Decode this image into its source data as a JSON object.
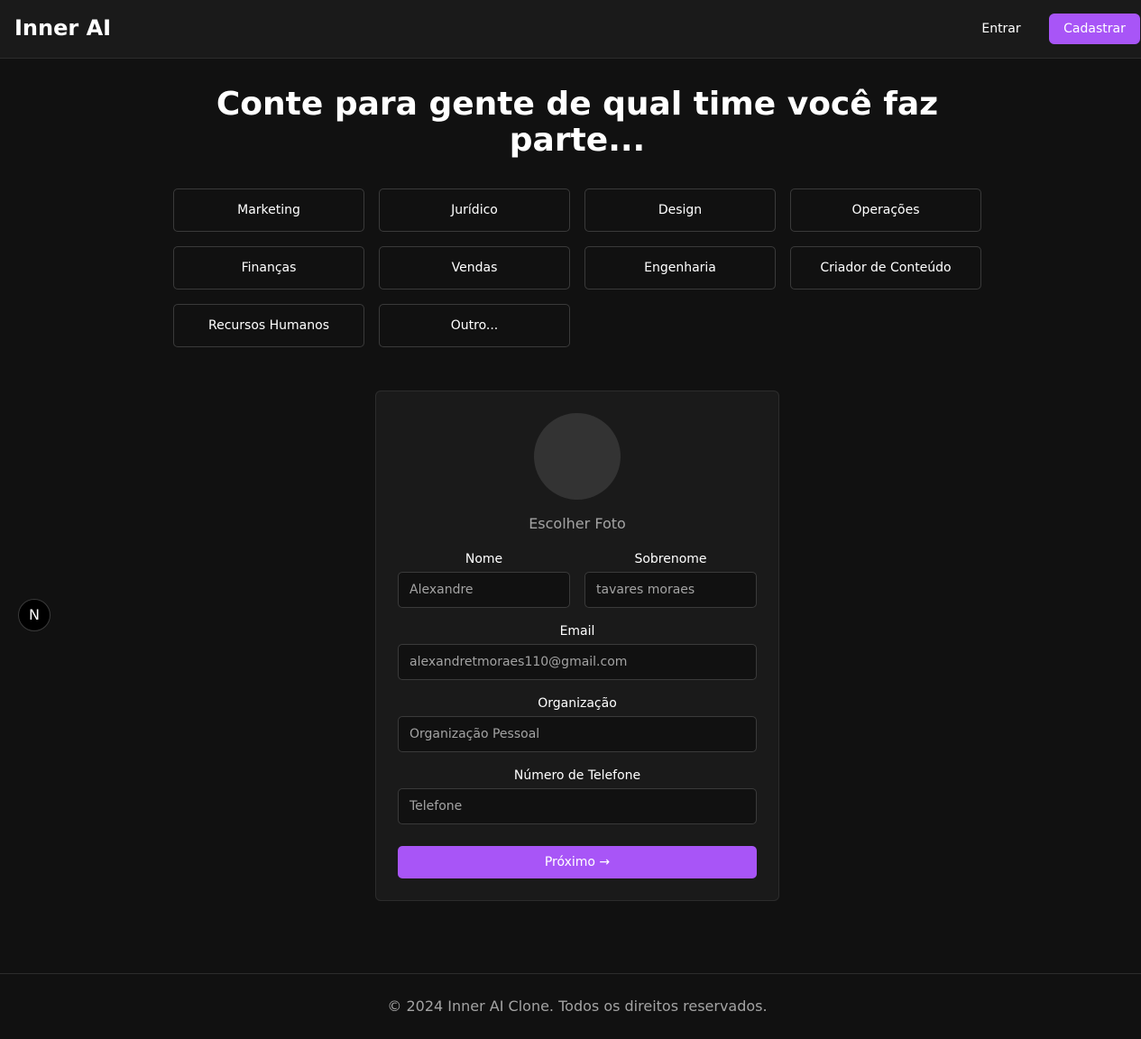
{
  "header": {
    "brand": "Inner AI",
    "login_label": "Entrar",
    "signup_label": "Cadastrar"
  },
  "main": {
    "title": "Conte para gente de qual time você faz parte...",
    "teams": [
      "Marketing",
      "Jurídico",
      "Design",
      "Operações",
      "Finanças",
      "Vendas",
      "Engenharia",
      "Criador de Conteúdo",
      "Recursos Humanos",
      "Outro..."
    ]
  },
  "form": {
    "photo_label": "Escolher Foto",
    "first_name": {
      "label": "Nome",
      "value": "Alexandre"
    },
    "last_name": {
      "label": "Sobrenome",
      "value": "tavares moraes"
    },
    "email": {
      "label": "Email",
      "value": "alexandretmoraes110@gmail.com"
    },
    "organization": {
      "label": "Organização",
      "value": "Organização Pessoal"
    },
    "phone": {
      "label": "Número de Telefone",
      "placeholder": "Telefone"
    },
    "next_label": "Próximo →"
  },
  "dev_badge": "N",
  "footer": {
    "copyright": "© 2024 Inner AI Clone. Todos os direitos reservados."
  },
  "colors": {
    "accent": "#a855f7",
    "background": "#111111",
    "surface": "#1a1a1a"
  }
}
